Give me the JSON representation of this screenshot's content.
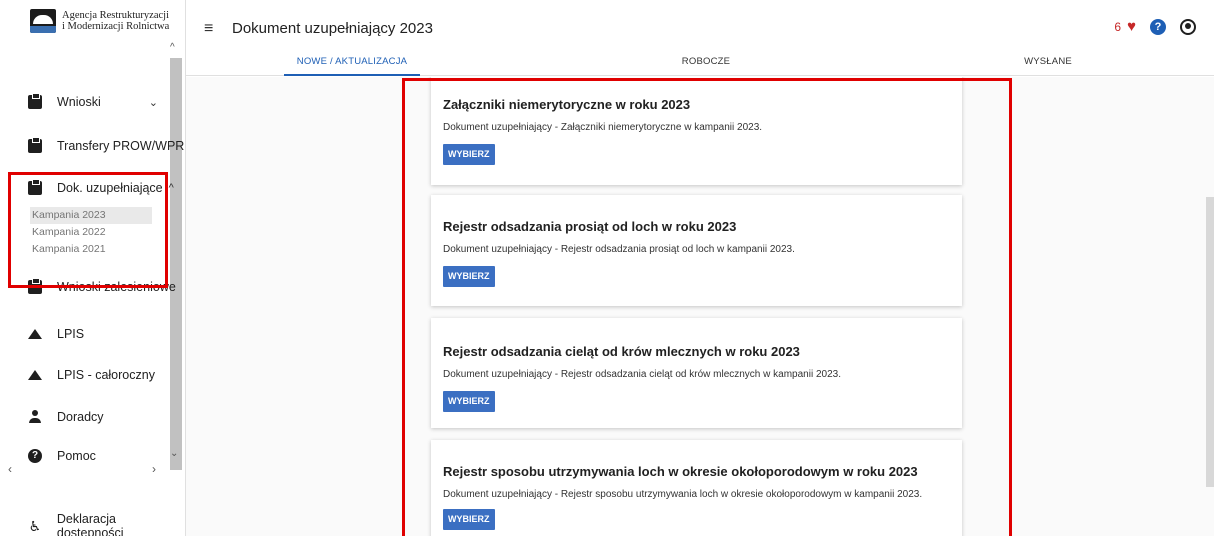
{
  "logo": {
    "line1": "Agencja Restrukturyzacji",
    "line2": "i Modernizacji Rolnictwa"
  },
  "header": {
    "title": "Dokument uzupełniający 2023",
    "notification_count": "6"
  },
  "tabs": [
    {
      "label": "NOWE / AKTUALIZACJA"
    },
    {
      "label": "ROBOCZE"
    },
    {
      "label": "WYSŁANE"
    }
  ],
  "sidebar": {
    "items": [
      {
        "label": "Wnioski",
        "icon": "clipboard-icon"
      },
      {
        "label": "Transfery PROW/WPR",
        "icon": "clipboard-icon"
      },
      {
        "label": "Dok. uzupełniające",
        "icon": "clipboard-icon"
      },
      {
        "label": "Wnioski zalesieniowe",
        "icon": "clipboard-icon"
      },
      {
        "label": "LPIS",
        "icon": "mountain-icon"
      },
      {
        "label": "LPIS - całoroczny",
        "icon": "mountain-icon"
      },
      {
        "label": "Doradcy",
        "icon": "person-icon"
      },
      {
        "label": "Pomoc",
        "icon": "help-icon"
      },
      {
        "label": "Deklaracja dostępności",
        "icon": "accessibility-icon"
      }
    ],
    "subitems": [
      {
        "label": "Kampania 2023",
        "active": true
      },
      {
        "label": "Kampania 2022"
      },
      {
        "label": "Kampania 2021"
      }
    ]
  },
  "cards": [
    {
      "title": "Załączniki niemerytoryczne w roku 2023",
      "description": "Dokument uzupełniający - Załączniki niemerytoryczne w kampanii 2023.",
      "button": "WYBIERZ"
    },
    {
      "title": "Rejestr odsadzania prosiąt od loch w roku 2023",
      "description": "Dokument uzupełniający - Rejestr odsadzania prosiąt od loch w kampanii 2023.",
      "button": "WYBIERZ"
    },
    {
      "title": "Rejestr odsadzania cieląt od krów mlecznych w roku 2023",
      "description": "Dokument uzupełniający - Rejestr odsadzania cieląt od krów mlecznych w kampanii 2023.",
      "button": "WYBIERZ"
    },
    {
      "title": "Rejestr sposobu utrzymywania loch w okresie okołoporodowym w roku 2023",
      "description": "Dokument uzupełniający - Rejestr sposobu utrzymywania loch w okresie okołoporodowym w kampanii 2023.",
      "button": "WYBIERZ"
    }
  ],
  "colors": {
    "accent": "#1e5fb5",
    "button": "#3b6fc2",
    "highlight": "#e00000",
    "notification": "#c62828"
  }
}
